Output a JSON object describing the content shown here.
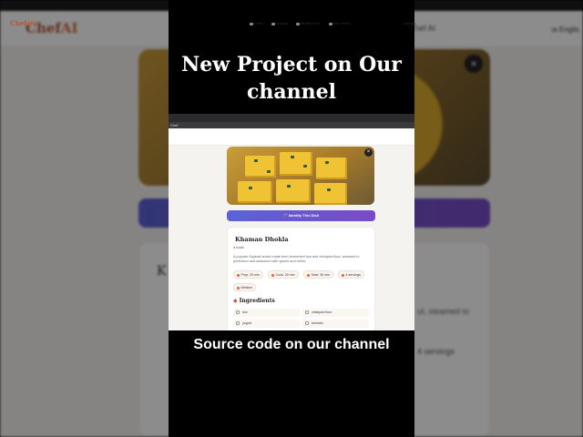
{
  "background": {
    "logo": "Chef",
    "logo_ai": "AI",
    "nav_partial": "hef AI",
    "lang": "ıa Englis",
    "heading_partial": "K",
    "desc_partial": "ut, steamed to",
    "servings": "4 servings"
  },
  "overlay": {
    "headline": "New Project on Our channel",
    "subline": "Source code on our channel"
  },
  "app": {
    "tab": "Chef",
    "logo": "Chef",
    "logo_ai": "AI",
    "nav": [
      {
        "label": "Home",
        "icon": "home-icon"
      },
      {
        "label": "Recipes",
        "icon": "book-icon"
      },
      {
        "label": "Identify Food",
        "icon": "camera-icon"
      },
      {
        "label": "Ask Chef AI",
        "icon": "chat-icon"
      }
    ],
    "lang": "ıa Englis",
    "close_glyph": "×",
    "identify_button": "🪄 Identify This Dish",
    "dish": {
      "title": "Khaman Dhokla",
      "origin": "India",
      "description": "A popular Gujarati snack made from fermented rice and chickpea flour, steamed to perfection and seasoned with spices and herbs.",
      "chips": [
        "Prep: 20 min",
        "Cook: 20 min",
        "Total: 30 min",
        "4 servings"
      ],
      "difficulty": "Medium"
    },
    "ingredients_title": "Ingredients",
    "ingredients": [
      "rice",
      "chickpea flour",
      "yogurt",
      "turmeric"
    ]
  },
  "colors": {
    "brand": "#b5533a",
    "accent_gradient_start": "#5a63d8",
    "accent_gradient_end": "#7b4ac6"
  }
}
